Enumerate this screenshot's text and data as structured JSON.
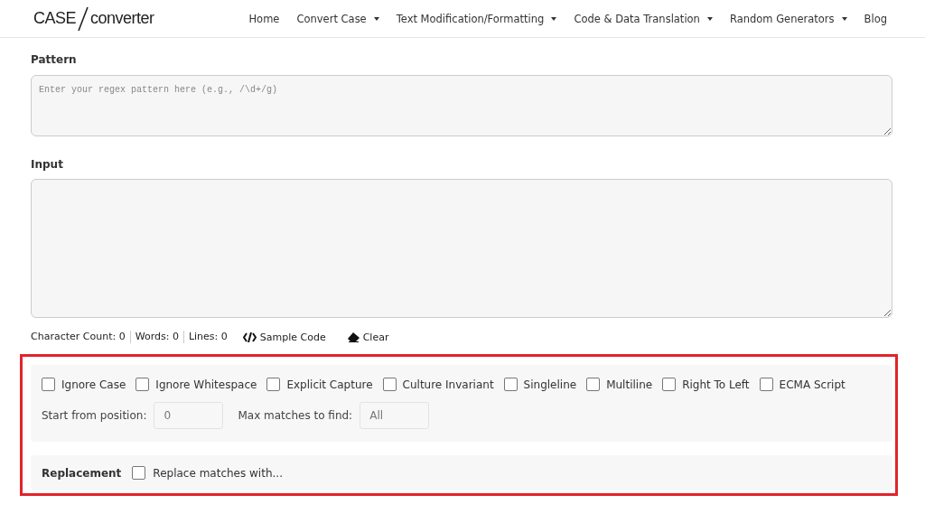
{
  "logo": {
    "left": "CASE",
    "right": "converter"
  },
  "nav": [
    {
      "label": "Home",
      "dropdown": false
    },
    {
      "label": "Convert Case",
      "dropdown": true
    },
    {
      "label": "Text Modification/Formatting",
      "dropdown": true
    },
    {
      "label": "Code & Data Translation",
      "dropdown": true
    },
    {
      "label": "Random Generators",
      "dropdown": true
    },
    {
      "label": "Blog",
      "dropdown": false
    }
  ],
  "pattern": {
    "label": "Pattern",
    "placeholder": "Enter your regex pattern here (e.g., /\\d+/g)"
  },
  "input": {
    "label": "Input"
  },
  "stats": [
    "Character Count: 0",
    "Words: 0",
    "Lines: 0"
  ],
  "actions": [
    {
      "kind": "code",
      "label": "Sample Code"
    },
    {
      "kind": "eraser",
      "label": "Clear"
    }
  ],
  "options": [
    {
      "label": "Ignore Case",
      "checked": false
    },
    {
      "label": "Ignore Whitespace",
      "checked": false
    },
    {
      "label": "Explicit Capture",
      "checked": false
    },
    {
      "label": "Culture Invariant",
      "checked": false
    },
    {
      "label": "Singleline",
      "checked": false
    },
    {
      "label": "Multiline",
      "checked": false
    },
    {
      "label": "Right To Left",
      "checked": false
    },
    {
      "label": "ECMA Script",
      "checked": false
    }
  ],
  "start": {
    "label": "Start from position:",
    "placeholder": "0"
  },
  "max": {
    "label": "Max matches to find:",
    "placeholder": "All"
  },
  "replacement": {
    "title": "Replacement",
    "label": "Replace matches with...",
    "checked": false
  }
}
